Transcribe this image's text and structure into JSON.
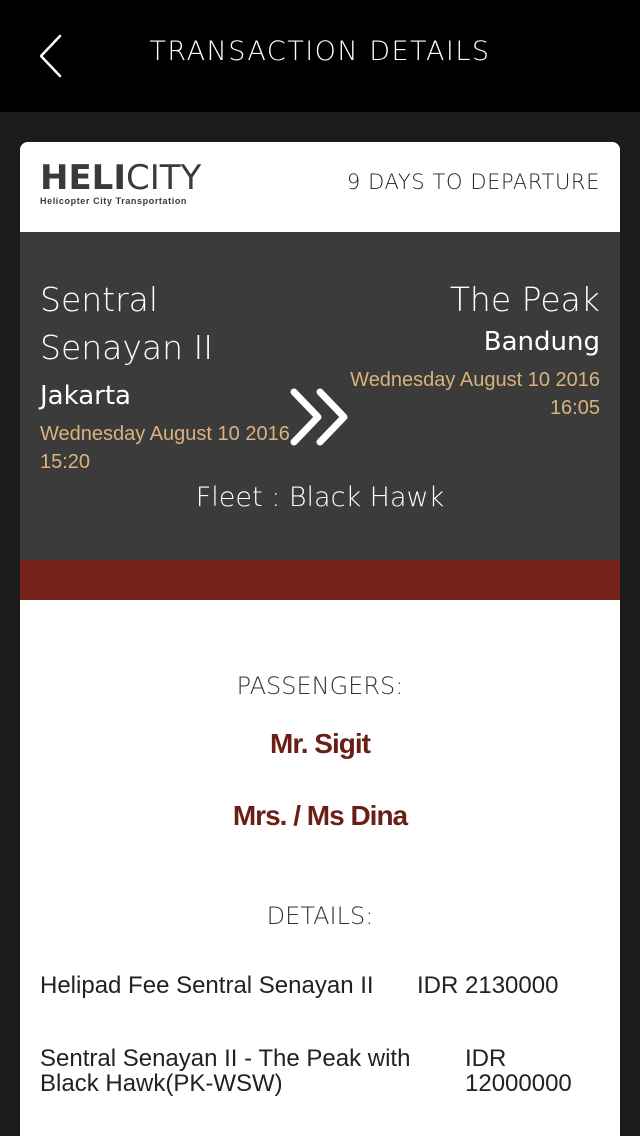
{
  "nav": {
    "title": "TRANSACTION DETAILS",
    "back_icon": "chevron-left-icon"
  },
  "header": {
    "logo_part1": "HELI",
    "logo_part2": "CITY",
    "logo_tagline": "Helicopter City Transportation",
    "days_to_departure": "9 DAYS TO DEPARTURE"
  },
  "route": {
    "origin": {
      "name": "Sentral Senayan II",
      "city": "Jakarta",
      "datetime": "Wednesday August 10 2016 15:20"
    },
    "destination": {
      "name": "The Peak",
      "city": "Bandung",
      "datetime": "Wednesday August 10 2016 16:05"
    },
    "fleet": "Fleet : Black Hawk",
    "arrow_icon": "double-chevron-right-icon"
  },
  "passengers": {
    "heading": "PASSENGERS:",
    "list": [
      "Mr. Sigit",
      "Mrs. / Ms Dina"
    ]
  },
  "details": {
    "heading": "DETAILS:",
    "items": [
      {
        "description": "Helipad Fee Sentral Senayan II",
        "amount": "IDR 2130000"
      },
      {
        "description": "Sentral Senayan II - The Peak with Black Hawk(PK-WSW)",
        "amount": "IDR 12000000"
      }
    ]
  },
  "colors": {
    "accent": "#762119",
    "datetime": "#d9b27c",
    "route_bg": "#3b3b3b",
    "passenger_name": "#6b1e16",
    "status_indicator": "#f5c400"
  }
}
